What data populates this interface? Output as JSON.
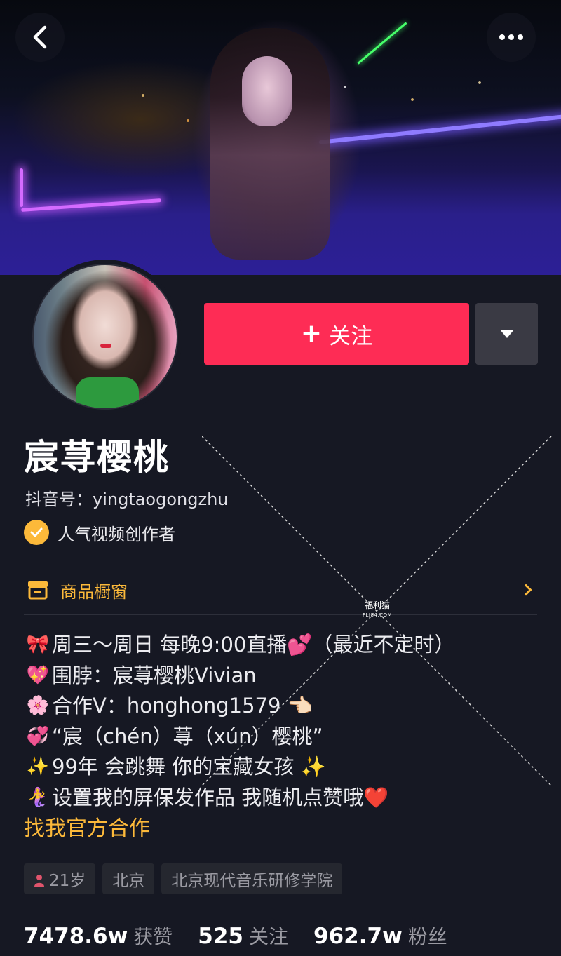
{
  "header": {
    "back_icon": "chevron-left-icon",
    "more_icon": "more-dots-icon"
  },
  "profile": {
    "name": "宸荨樱桃",
    "douyin_id": "抖音号：yingtaogongzhu",
    "badge": "人气视频创作者"
  },
  "actions": {
    "follow_label": "关注",
    "follow_plus": "+",
    "follow_color": "#fe2c55"
  },
  "shop": {
    "label": "商品橱窗",
    "accent": "#fcb93a"
  },
  "bio": {
    "lines": [
      {
        "emoji": "🎀",
        "text": "周三～周日 每晚9:00直播💕（最近不定时）"
      },
      {
        "emoji": "💖",
        "text": "围脖：宸荨樱桃Vivian"
      },
      {
        "emoji": "🌸",
        "text": "合作V：honghong1579 👈🏻"
      },
      {
        "emoji": "💞",
        "text": "“宸（chén）荨（xún）樱桃”"
      },
      {
        "emoji": "✨",
        "text": "99年 会跳舞 你的宝藏女孩 ✨"
      },
      {
        "emoji": "🧜‍♀️",
        "text": "设置我的屏保发作品  我随机点赞哦❤️"
      }
    ],
    "cooperation_link": "找我官方合作"
  },
  "tags": {
    "age": "21岁",
    "city": "北京",
    "school": "北京现代音乐研修学院"
  },
  "stats": {
    "likes_value": "7478.6w",
    "likes_label": "获赞",
    "following_value": "525",
    "following_label": "关注",
    "followers_value": "962.7w",
    "followers_label": "粉丝"
  },
  "watermark": {
    "title": "福利猫",
    "sub": "FLI84.COM"
  }
}
